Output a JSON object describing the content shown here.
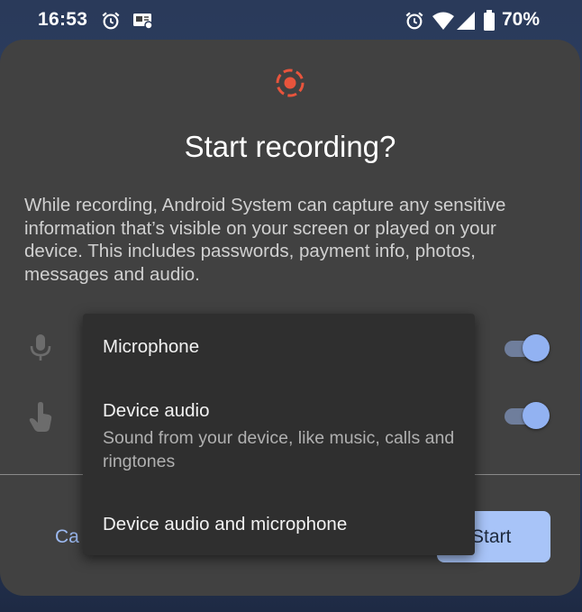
{
  "status_bar": {
    "time": "16:53",
    "battery": "70%",
    "left_icons": [
      "alarm-icon",
      "notification-icon"
    ],
    "right_icons": [
      "alarm-icon",
      "wifi-icon",
      "signal-icon",
      "battery-icon"
    ]
  },
  "dialog": {
    "icon": "screen-record-icon",
    "title": "Start recording?",
    "message": "While recording, Android System can capture any sensitive information that’s visible on your screen or played on your device. This includes passwords, payment info, photos, messages and audio.",
    "options": [
      {
        "icon": "microphone-icon",
        "enabled": true
      },
      {
        "icon": "touch-icon",
        "enabled": true
      }
    ],
    "cancel_label": "Ca",
    "start_label": "Start"
  },
  "menu": {
    "items": [
      {
        "title": "Microphone",
        "description": ""
      },
      {
        "title": "Device audio",
        "description": "Sound from your device, like music, calls and ringtones"
      },
      {
        "title": "Device audio and microphone",
        "description": ""
      }
    ]
  },
  "colors": {
    "dialog_bg": "#414141",
    "menu_bg": "#2f2f2f",
    "accent": "#92b2f2",
    "record_red": "#e8543c"
  }
}
